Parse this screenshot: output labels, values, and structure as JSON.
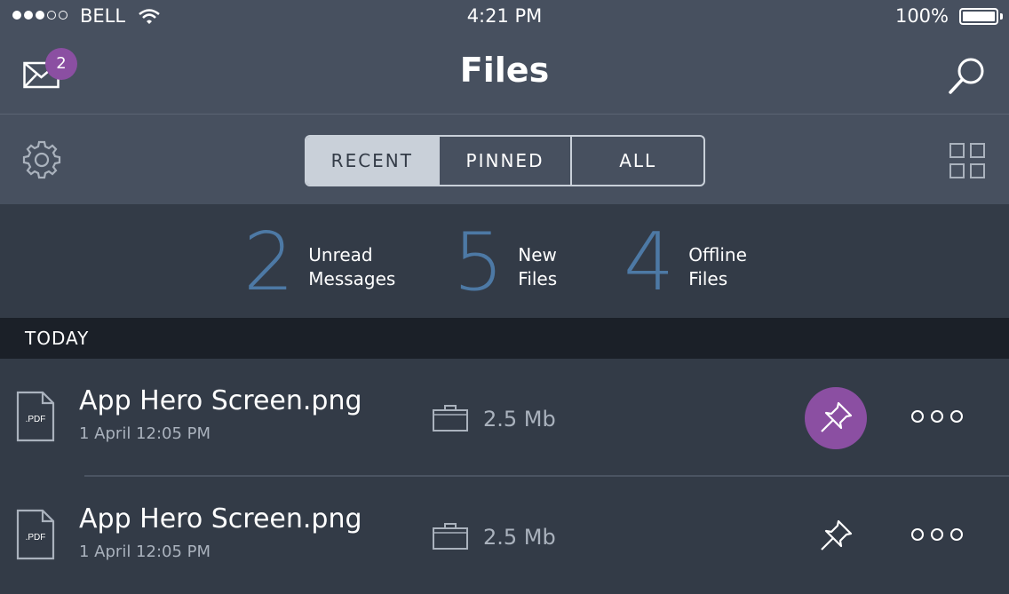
{
  "status_bar": {
    "carrier": "BELL",
    "time": "4:21 PM",
    "battery": "100%"
  },
  "nav": {
    "title": "Files",
    "mail_badge": "2"
  },
  "tabs": [
    {
      "label": "RECENT",
      "active": true
    },
    {
      "label": "PINNED",
      "active": false
    },
    {
      "label": "ALL",
      "active": false
    }
  ],
  "stats": [
    {
      "value": "2",
      "line1": "Unread",
      "line2": "Messages"
    },
    {
      "value": "5",
      "line1": "New",
      "line2": "Files"
    },
    {
      "value": "4",
      "line1": "Offline",
      "line2": "Files"
    }
  ],
  "section": {
    "label": "TODAY"
  },
  "files": [
    {
      "icon_label": ".PDF",
      "name": "App Hero Screen.png",
      "date": "1 April 12:05 PM",
      "size": "2.5 Mb",
      "pinned": true
    },
    {
      "icon_label": ".PDF",
      "name": "App Hero Screen.png",
      "date": "1 April 12:05 PM",
      "size": "2.5 Mb",
      "pinned": false
    }
  ],
  "colors": {
    "top_bar": "#47505f",
    "background": "#333b47",
    "accent_blue": "#4d79a5",
    "accent_purple": "#8b4fa2",
    "section_header": "#1b2028"
  }
}
